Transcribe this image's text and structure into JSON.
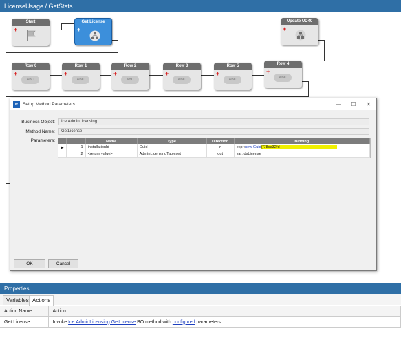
{
  "header": {
    "title": "LicenseUsage / GetStats"
  },
  "nodes": {
    "start": "Start",
    "get_license": "Get License",
    "update_ud40": "Update UD40",
    "row0": "Row 0",
    "row1": "Row 1",
    "row2": "Row 2",
    "row3": "Row 3",
    "row5": "Row 5",
    "row4": "Row 4",
    "abc": "ABC"
  },
  "dialog": {
    "title": "Setup Method Parameters",
    "business_object_label": "Business Object:",
    "business_object_value": "Ice.AdminLicensing",
    "method_name_label": "Method Name:",
    "method_name_value": "GetLicense",
    "parameters_label": "Parameters:",
    "columns": [
      "Name",
      "Type",
      "Direction",
      "Binding"
    ],
    "rows": [
      {
        "index": "1",
        "name": "installationId",
        "type": "Guid",
        "direction": "in",
        "binding_prefix": "expr:",
        "binding_link": "new Guid",
        "binding_value": "(\"78ca32fd-"
      },
      {
        "index": "2",
        "name": "<return value>",
        "type": "AdminLicensingTableset",
        "direction": "out",
        "binding_prefix": "var: dsLicense",
        "binding_link": "",
        "binding_value": ""
      }
    ],
    "ok": "OK",
    "cancel": "Cancel"
  },
  "properties": {
    "header": "Properties",
    "tabs": [
      "Variables",
      "Actions"
    ],
    "col_action_name": "Action Name",
    "col_action": "Action",
    "row_name": "Get License",
    "row_text_1": "Invoke ",
    "row_link_1": "Ice.AdminLicensing.GetLicense",
    "row_text_2": " BO method with ",
    "row_link_2": "configured",
    "row_text_3": " parameters"
  },
  "colors": {
    "header_blue": "#2f6fa6",
    "selected_node": "#3c8fdb",
    "highlight": "#f0f000",
    "link": "#1d3fbf"
  }
}
